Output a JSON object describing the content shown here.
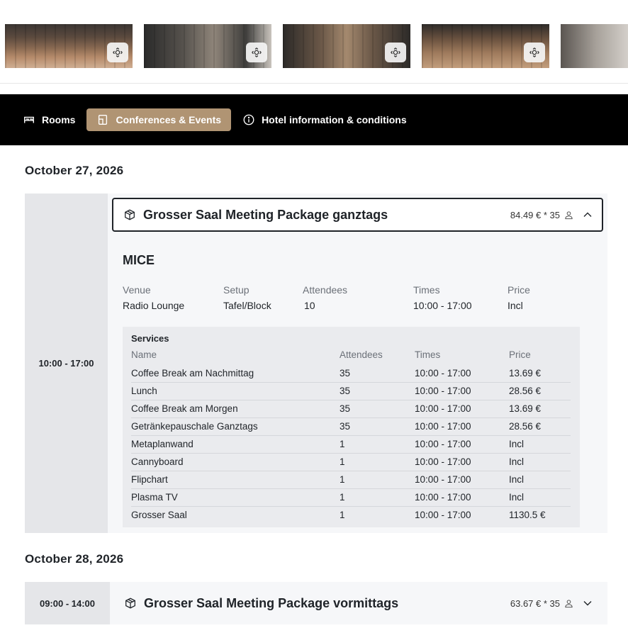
{
  "gallery": {
    "image_count": 5
  },
  "tabs": [
    {
      "label": "Rooms",
      "icon": "bed-icon",
      "active": false
    },
    {
      "label": "Conferences & Events",
      "icon": "door-icon",
      "active": true
    },
    {
      "label": "Hotel information & conditions",
      "icon": "info-icon",
      "active": false
    }
  ],
  "colors": {
    "active_tab": "#b09473",
    "tabbar_bg": "#000000"
  },
  "day1": {
    "date": "October 27, 2026",
    "time_range": "10:00 - 17:00",
    "package": {
      "title": "Grosser Saal Meeting Package ganztags",
      "price": "84.49 € * 35",
      "expanded": true
    },
    "mice": {
      "title": "MICE",
      "labels": {
        "venue": "Venue",
        "setup": "Setup",
        "attendees": "Attendees",
        "times": "Times",
        "price": "Price"
      },
      "values": {
        "venue": "Radio Lounge",
        "setup": "Tafel/Block",
        "attendees": "10",
        "times": "10:00 - 17:00",
        "price": "Incl"
      }
    },
    "services": {
      "title": "Services",
      "headers": {
        "name": "Name",
        "attendees": "Attendees",
        "times": "Times",
        "price": "Price"
      },
      "rows": [
        {
          "name": "Coffee Break am Nachmittag",
          "attendees": "35",
          "times": "10:00 - 17:00",
          "price": "13.69 €"
        },
        {
          "name": "Lunch",
          "attendees": "35",
          "times": "10:00 - 17:00",
          "price": "28.56 €"
        },
        {
          "name": "Coffee Break am Morgen",
          "attendees": "35",
          "times": "10:00 - 17:00",
          "price": "13.69 €"
        },
        {
          "name": "Getränkepauschale Ganztags",
          "attendees": "35",
          "times": "10:00 - 17:00",
          "price": "28.56 €"
        },
        {
          "name": "Metaplanwand",
          "attendees": "1",
          "times": "10:00 - 17:00",
          "price": "Incl"
        },
        {
          "name": "Cannyboard",
          "attendees": "1",
          "times": "10:00 - 17:00",
          "price": "Incl"
        },
        {
          "name": "Flipchart",
          "attendees": "1",
          "times": "10:00 - 17:00",
          "price": "Incl"
        },
        {
          "name": "Plasma TV",
          "attendees": "1",
          "times": "10:00 - 17:00",
          "price": "Incl"
        },
        {
          "name": "Grosser Saal",
          "attendees": "1",
          "times": "10:00 - 17:00",
          "price": "1130.5 €"
        }
      ]
    }
  },
  "day2": {
    "date": "October 28, 2026",
    "time_range": "09:00 - 14:00",
    "package": {
      "title": "Grosser Saal Meeting Package vormittags",
      "price": "63.67 € * 35",
      "expanded": false
    }
  }
}
